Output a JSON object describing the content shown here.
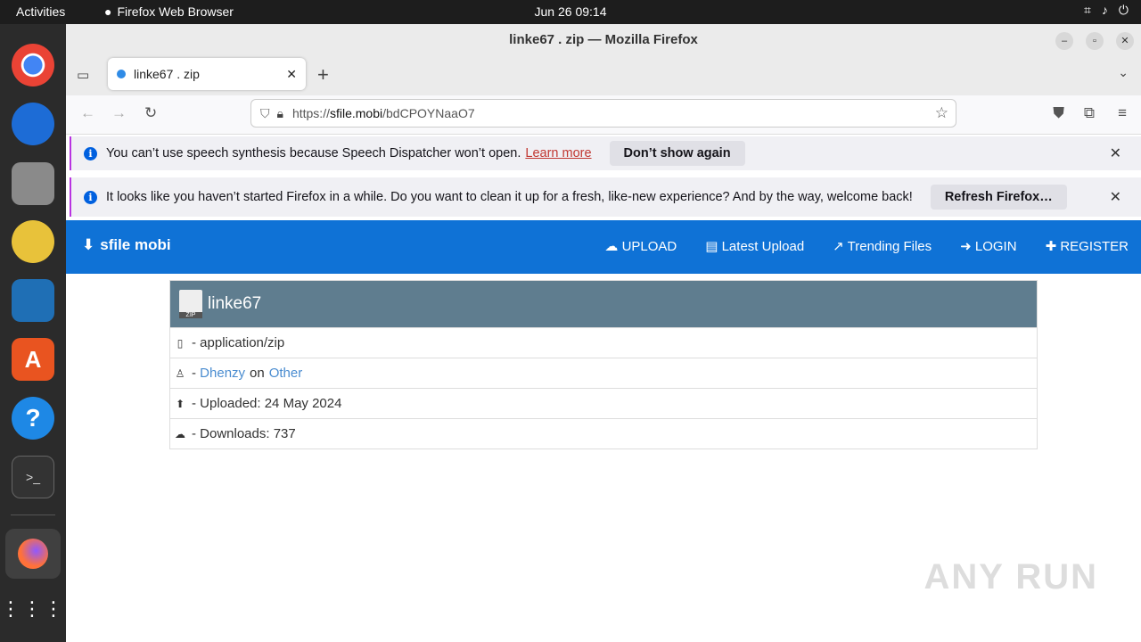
{
  "system": {
    "activities": "Activities",
    "app_name": "Firefox Web Browser",
    "clock": "Jun 26  09:14"
  },
  "window": {
    "title": "linke67 . zip — Mozilla Firefox"
  },
  "tab": {
    "title": "linke67 . zip"
  },
  "nav": {
    "url_domain": "sfile.mobi",
    "url_prefix": "https://",
    "url_path": "/bdCPOYNaaO7"
  },
  "notifications": [
    {
      "text": "You can’t use speech synthesis because Speech Dispatcher won’t open.",
      "link": "Learn more",
      "button": "Don’t show again"
    },
    {
      "text": "It looks like you haven’t started Firefox in a while. Do you want to clean it up for a fresh, like-new experience? And by the way, welcome back!",
      "button": "Refresh Firefox…"
    }
  ],
  "site": {
    "brand": "sfile mobi",
    "menu": [
      "UPLOAD",
      "Latest Upload",
      "Trending Files",
      "LOGIN",
      "REGISTER"
    ]
  },
  "file": {
    "name": "linke67",
    "icon_label": "ZIP",
    "mime": "- application/zip",
    "uploader": "Dhenzy",
    "on": "on",
    "category": "Other",
    "uploaded": "- Uploaded: 24 May 2024",
    "downloads": "- Downloads: 737"
  },
  "watermark": "ANY RUN",
  "colors": {
    "site_nav": "#0f72d6",
    "panel_head": "#5f7d8f",
    "link": "#4a8cd0"
  }
}
